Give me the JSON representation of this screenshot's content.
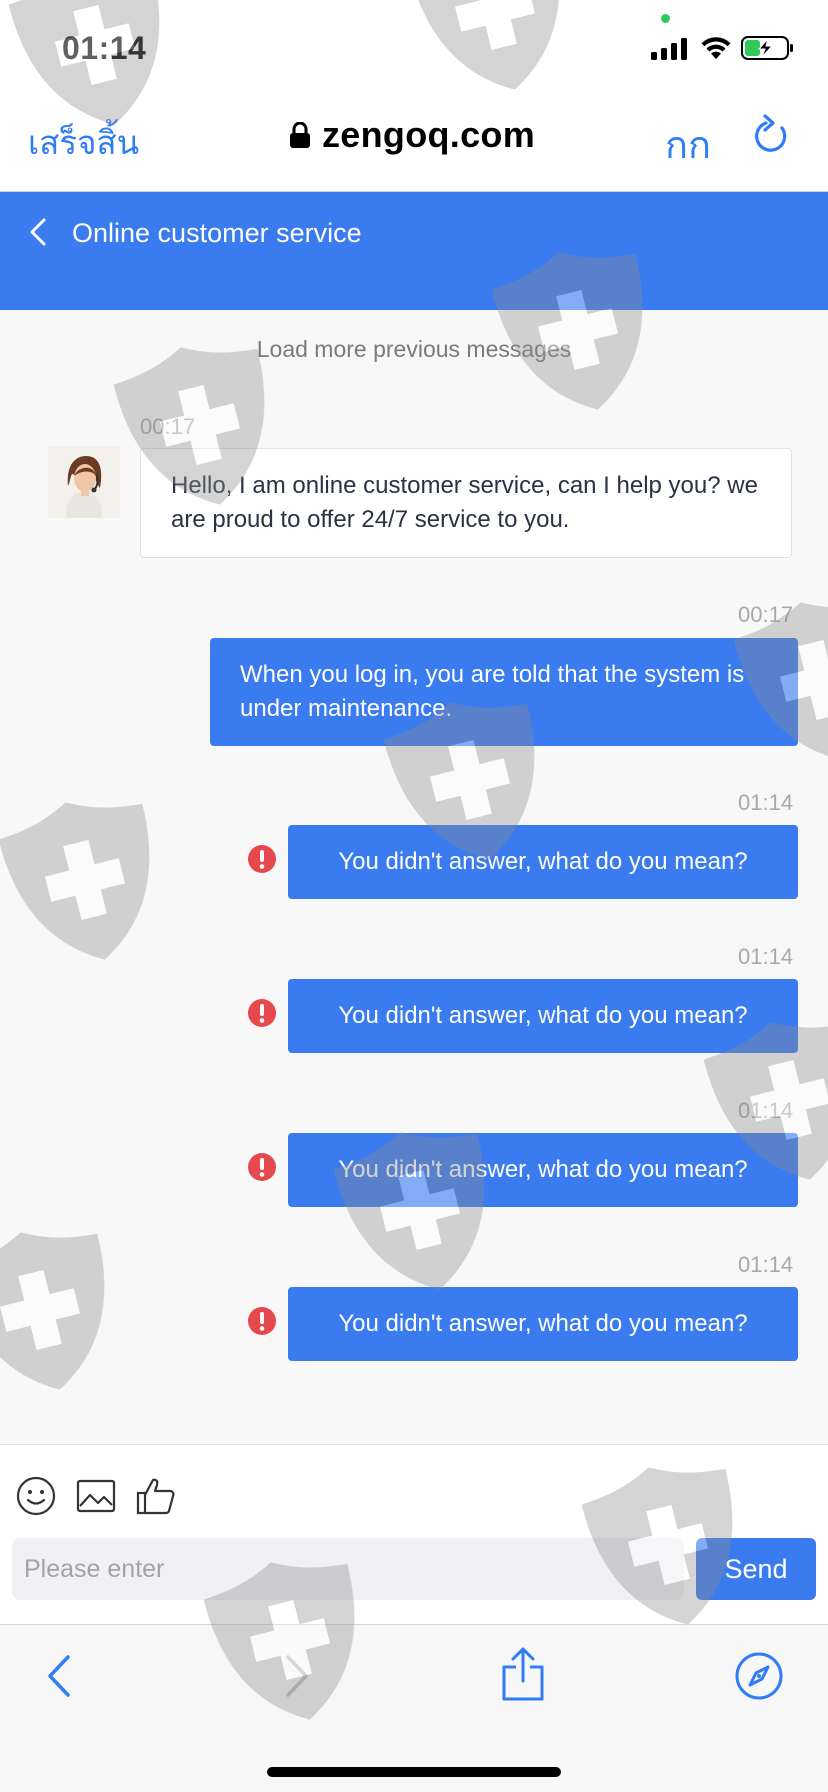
{
  "status_bar": {
    "time": "01:14"
  },
  "browser": {
    "done_label": "เสร็จสิ้น",
    "url": "zengoq.com",
    "text_size_label": "กก"
  },
  "header": {
    "title": "Online customer service"
  },
  "chat": {
    "load_more": "Load more previous messages",
    "messages": [
      {
        "from": "agent",
        "time": "00:17",
        "text": "Hello, I am online customer service, can I help you? we are proud to offer 24/7 service to you.",
        "status": "sent"
      },
      {
        "from": "user",
        "time": "00:17",
        "text": "When you log in, you are told that the system is under maintenance.",
        "status": "sent"
      },
      {
        "from": "user",
        "time": "01:14",
        "text": "You didn't answer, what do you mean?",
        "status": "failed"
      },
      {
        "from": "user",
        "time": "01:14",
        "text": "You didn't answer, what do you mean?",
        "status": "failed"
      },
      {
        "from": "user",
        "time": "01:14",
        "text": "You didn't answer, what do you mean?",
        "status": "failed"
      },
      {
        "from": "user",
        "time": "01:14",
        "text": "You didn't answer, what do you mean?",
        "status": "failed"
      }
    ]
  },
  "composer": {
    "tools": [
      "smile-icon",
      "image-icon",
      "thumbs-up-icon"
    ],
    "placeholder": "Please enter",
    "send_label": "Send"
  },
  "bottom_bar": {
    "buttons": [
      "back-icon",
      "forward-icon",
      "share-icon",
      "compass-icon"
    ]
  },
  "colors": {
    "accent": "#3a7bf0",
    "safari_blue": "#2f7cf6",
    "error": "#e5484d"
  }
}
